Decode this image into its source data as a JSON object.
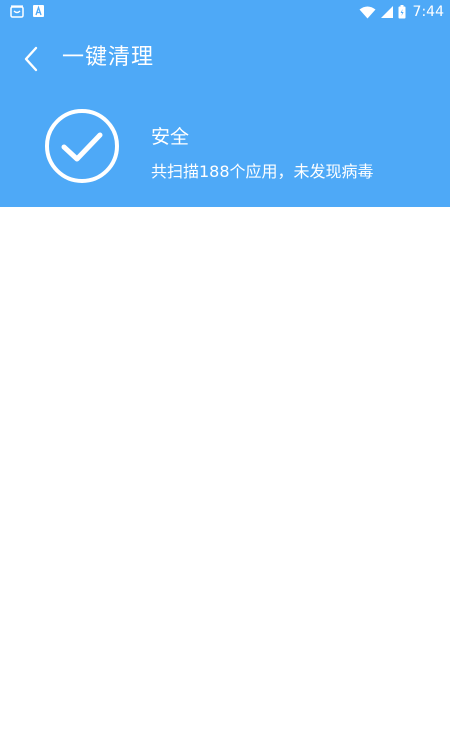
{
  "status_bar": {
    "time": "7:44",
    "icons": [
      "notification-app-icon",
      "notification-a-icon",
      "wifi-icon",
      "signal-icon",
      "battery-icon"
    ]
  },
  "toolbar": {
    "title": "一键清理",
    "back_icon": "chevron-left-icon"
  },
  "result": {
    "icon": "check-circle-icon",
    "title": "安全",
    "description": "共扫描188个应用，未发现病毒"
  },
  "colors": {
    "header_bg": "#4ea9f7",
    "text": "#ffffff",
    "content_bg": "#ffffff"
  }
}
